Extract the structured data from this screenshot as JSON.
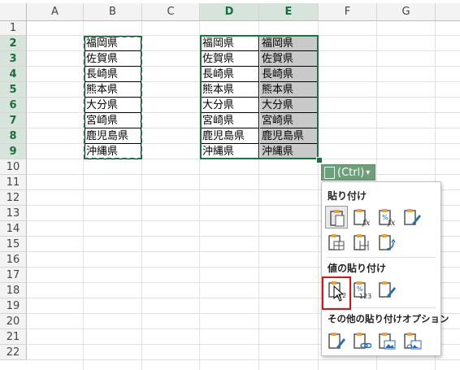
{
  "columns": [
    "A",
    "B",
    "C",
    "D",
    "E",
    "F",
    "G"
  ],
  "rows": [
    "1",
    "2",
    "3",
    "4",
    "5",
    "6",
    "7",
    "8",
    "9",
    "10",
    "11",
    "12",
    "13",
    "14",
    "15",
    "16",
    "17",
    "18",
    "19",
    "20",
    "21",
    "22"
  ],
  "source_column_B": [
    "福岡県",
    "佐賀県",
    "長崎県",
    "熊本県",
    "大分県",
    "宮崎県",
    "鹿児島県",
    "沖縄県"
  ],
  "pasted_column_D": [
    "福岡県",
    "佐賀県",
    "長崎県",
    "熊本県",
    "大分県",
    "宮崎県",
    "鹿児島県",
    "沖縄県"
  ],
  "pasted_column_E": [
    "福岡県",
    "佐賀県",
    "長崎県",
    "熊本県",
    "大分県",
    "宮崎県",
    "鹿児島県",
    "沖縄県"
  ],
  "paste_button": {
    "label": "(Ctrl)",
    "arrow": "▾"
  },
  "paste_menu": {
    "section1": "貼り付け",
    "section2": "値の貼り付け",
    "section3": "その他の貼り付けオプション",
    "icons_row1": [
      "paste-icon",
      "paste-formulas-icon",
      "paste-formulas-number-format-icon",
      "paste-keep-source-formatting-icon"
    ],
    "icons_row2": [
      "paste-no-borders-icon",
      "paste-keep-column-widths-icon",
      "paste-transpose-icon"
    ],
    "icons_row3": [
      "paste-values-icon",
      "paste-values-number-format-icon",
      "paste-values-source-formatting-icon"
    ],
    "icons_row4": [
      "paste-formatting-icon",
      "paste-link-icon",
      "paste-picture-icon",
      "paste-linked-picture-icon"
    ]
  },
  "colors": {
    "accent": "#1e7145",
    "selected_header": "#d7e4dc",
    "gray_cell": "#c9c9c9",
    "highlight": "#dd1111"
  }
}
